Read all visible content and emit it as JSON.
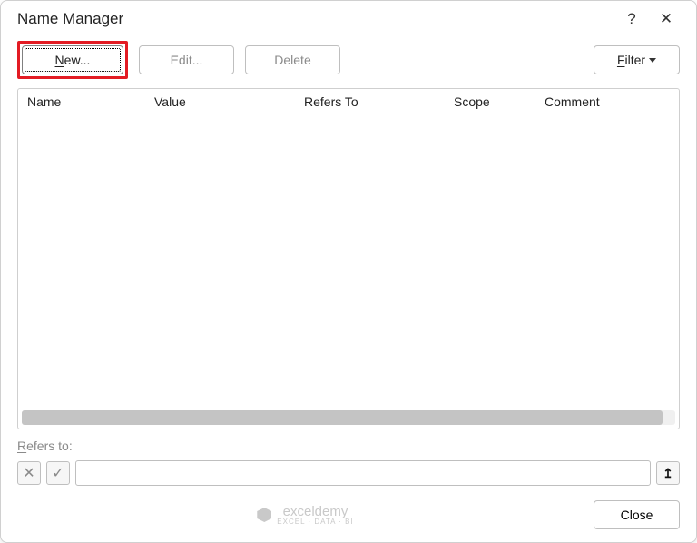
{
  "title": "Name Manager",
  "titlebar": {
    "help": "?",
    "close": "✕"
  },
  "toolbar": {
    "new_label": "New...",
    "new_underline": "N",
    "edit_label": "Edit...",
    "delete_label": "Delete",
    "filter_label": "ilter",
    "filter_underline": "F"
  },
  "columns": {
    "name": "Name",
    "value": "Value",
    "refers": "Refers To",
    "scope": "Scope",
    "comment": "Comment"
  },
  "refers": {
    "label_underline": "R",
    "label_rest": "efers to:",
    "value": ""
  },
  "footer": {
    "watermark": "exceldemy",
    "watermark_sub": "EXCEL · DATA · BI",
    "close": "Close"
  },
  "icons": {
    "cancel": "✕",
    "confirm": "✓",
    "collapse": "↥"
  }
}
